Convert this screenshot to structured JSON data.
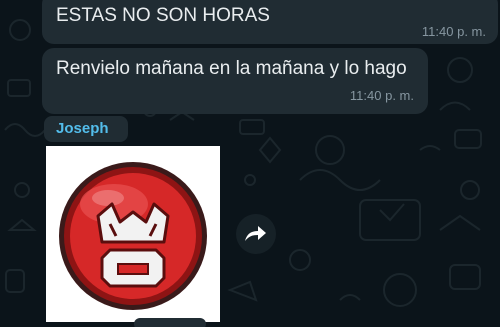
{
  "messages": [
    {
      "text": "ESTAS NO SON HORAS",
      "time": "11:40 p. m."
    },
    {
      "text": "Renvielo mañana en la mañana y lo hago",
      "time": "11:40 p. m."
    }
  ],
  "sticker_message": {
    "sender": "Joseph",
    "sticker_icon": "angry-face-icon"
  },
  "forward_icon": "forward-double-arrow-icon",
  "colors": {
    "background": "#0b141a",
    "bubble": "#202c33",
    "sender_name": "#53bdeb",
    "timestamp": "#8696a0",
    "sticker_face": "#d62828"
  }
}
